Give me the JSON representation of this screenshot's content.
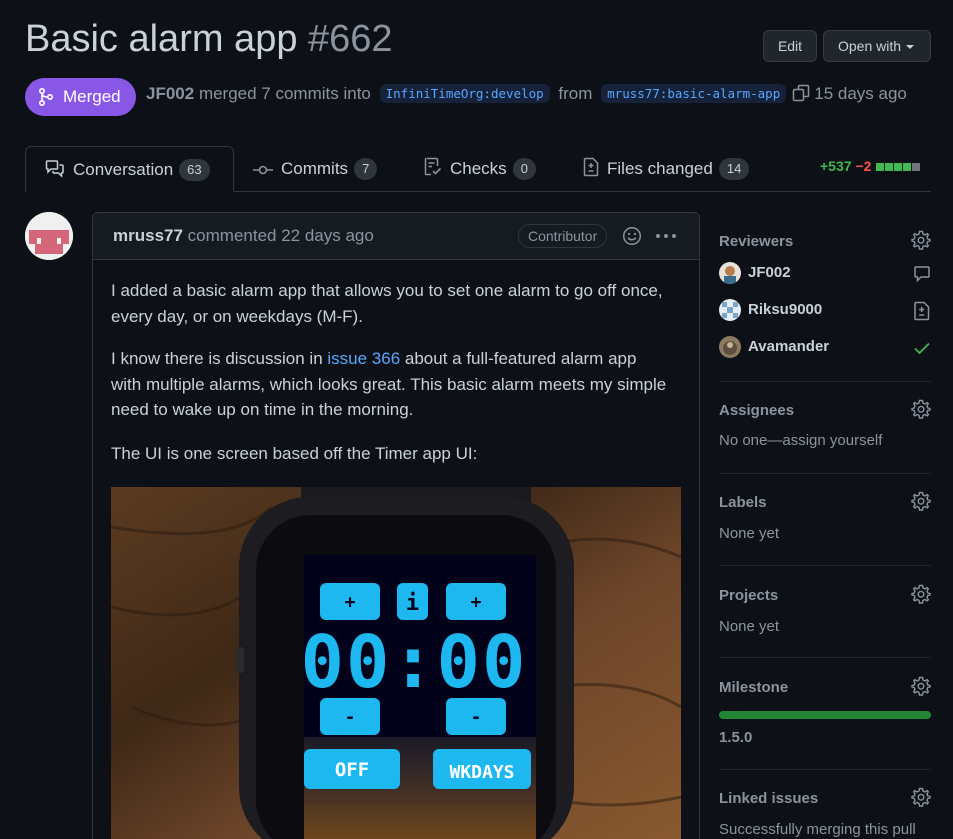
{
  "pr": {
    "title": "Basic alarm app",
    "number": "#662",
    "state_label": "Merged",
    "merged_by": "JF002",
    "merged_text": "merged 7 commits into",
    "base_branch": "InfiniTimeOrg:develop",
    "from_text": "from",
    "head_branch": "mruss77:basic-alarm-app",
    "time_ago": "15 days ago"
  },
  "header_buttons": {
    "edit": "Edit",
    "open_with": "Open with"
  },
  "tabs": [
    {
      "label": "Conversation",
      "count": "63",
      "icon": "comment-discussion-icon"
    },
    {
      "label": "Commits",
      "count": "7",
      "icon": "git-commit-icon"
    },
    {
      "label": "Checks",
      "count": "0",
      "icon": "checklist-icon"
    },
    {
      "label": "Files changed",
      "count": "14",
      "icon": "file-diff-icon"
    }
  ],
  "diffstat": {
    "additions": "+537",
    "deletions": "−2"
  },
  "comment": {
    "author": "mruss77",
    "action": "commented 22 days ago",
    "role_badge": "Contributor",
    "p1": "I added a basic alarm app that allows you to set one alarm to go off once, every day, or on weekdays (M-F).",
    "p2_before": "I know there is discussion in ",
    "p2_link": "issue 366",
    "p2_after": " about a full-featured alarm app with multiple alarms, which looks great. This basic alarm meets my simple need to wake up on time in the morning.",
    "p3": "The UI is one screen based off the Timer app UI:"
  },
  "watch_screen": {
    "plus": "+",
    "info": "i",
    "time": "00:00",
    "minus": "-",
    "off": "OFF",
    "mode": "WKDAYS"
  },
  "sidebar": {
    "reviewers": {
      "title": "Reviewers",
      "items": [
        {
          "name": "JF002",
          "status": "commented-icon"
        },
        {
          "name": "Riksu9000",
          "status": "file-diff-icon"
        },
        {
          "name": "Avamander",
          "status": "approved-check-icon"
        }
      ]
    },
    "assignees": {
      "title": "Assignees",
      "value": "No one—assign yourself"
    },
    "labels": {
      "title": "Labels",
      "value": "None yet"
    },
    "projects": {
      "title": "Projects",
      "value": "None yet"
    },
    "milestone": {
      "title": "Milestone",
      "value": "1.5.0",
      "progress": 1.0
    },
    "linked_issues": {
      "title": "Linked issues",
      "value": "Successfully merging this pull"
    }
  },
  "colors": {
    "merged_purple": "#8957e5",
    "link_blue": "#58a6ff",
    "add_green": "#3fb950",
    "del_red": "#f85149"
  }
}
